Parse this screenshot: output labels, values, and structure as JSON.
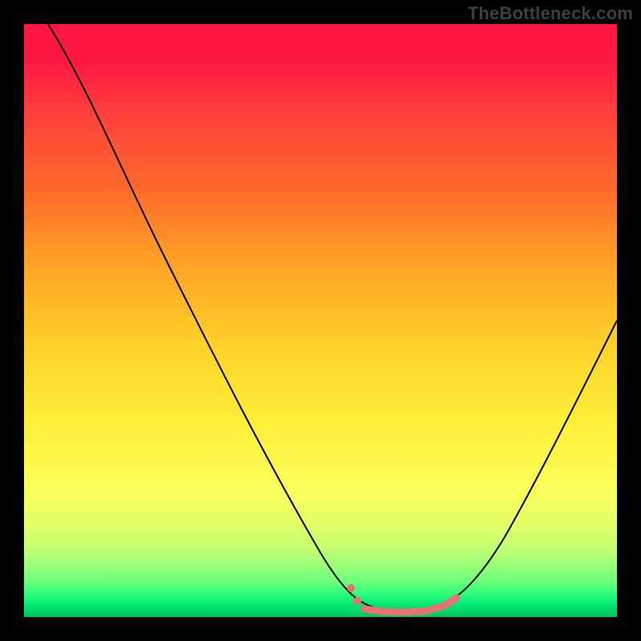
{
  "watermark": "TheBottleneck.com",
  "colors": {
    "background": "#000000",
    "gradient_top": "#ff1744",
    "gradient_bottom": "#00c853",
    "curve": "#000000",
    "marker": "#e57373"
  },
  "chart_data": {
    "type": "line",
    "title": "",
    "xlabel": "",
    "ylabel": "",
    "xlim": [
      0,
      100
    ],
    "ylim": [
      0,
      100
    ],
    "x": [
      0,
      5,
      10,
      15,
      20,
      25,
      30,
      35,
      40,
      45,
      50,
      55,
      58,
      60,
      62,
      65,
      68,
      70,
      75,
      80,
      85,
      90,
      95,
      100
    ],
    "values": [
      100,
      93,
      85,
      76,
      68,
      59,
      51,
      43,
      35,
      26,
      18,
      10,
      5,
      3,
      2,
      1,
      1,
      2,
      6,
      13,
      22,
      31,
      41,
      51
    ],
    "marker_segment": {
      "x_start": 56,
      "x_end": 73,
      "y": 1.5
    },
    "marker_points": [
      {
        "x": 55,
        "y": 7
      },
      {
        "x": 56,
        "y": 4
      }
    ],
    "note": "Approximate V-shaped bottleneck curve read from pixels; y=0 is green bottom, y=100 is red top."
  }
}
